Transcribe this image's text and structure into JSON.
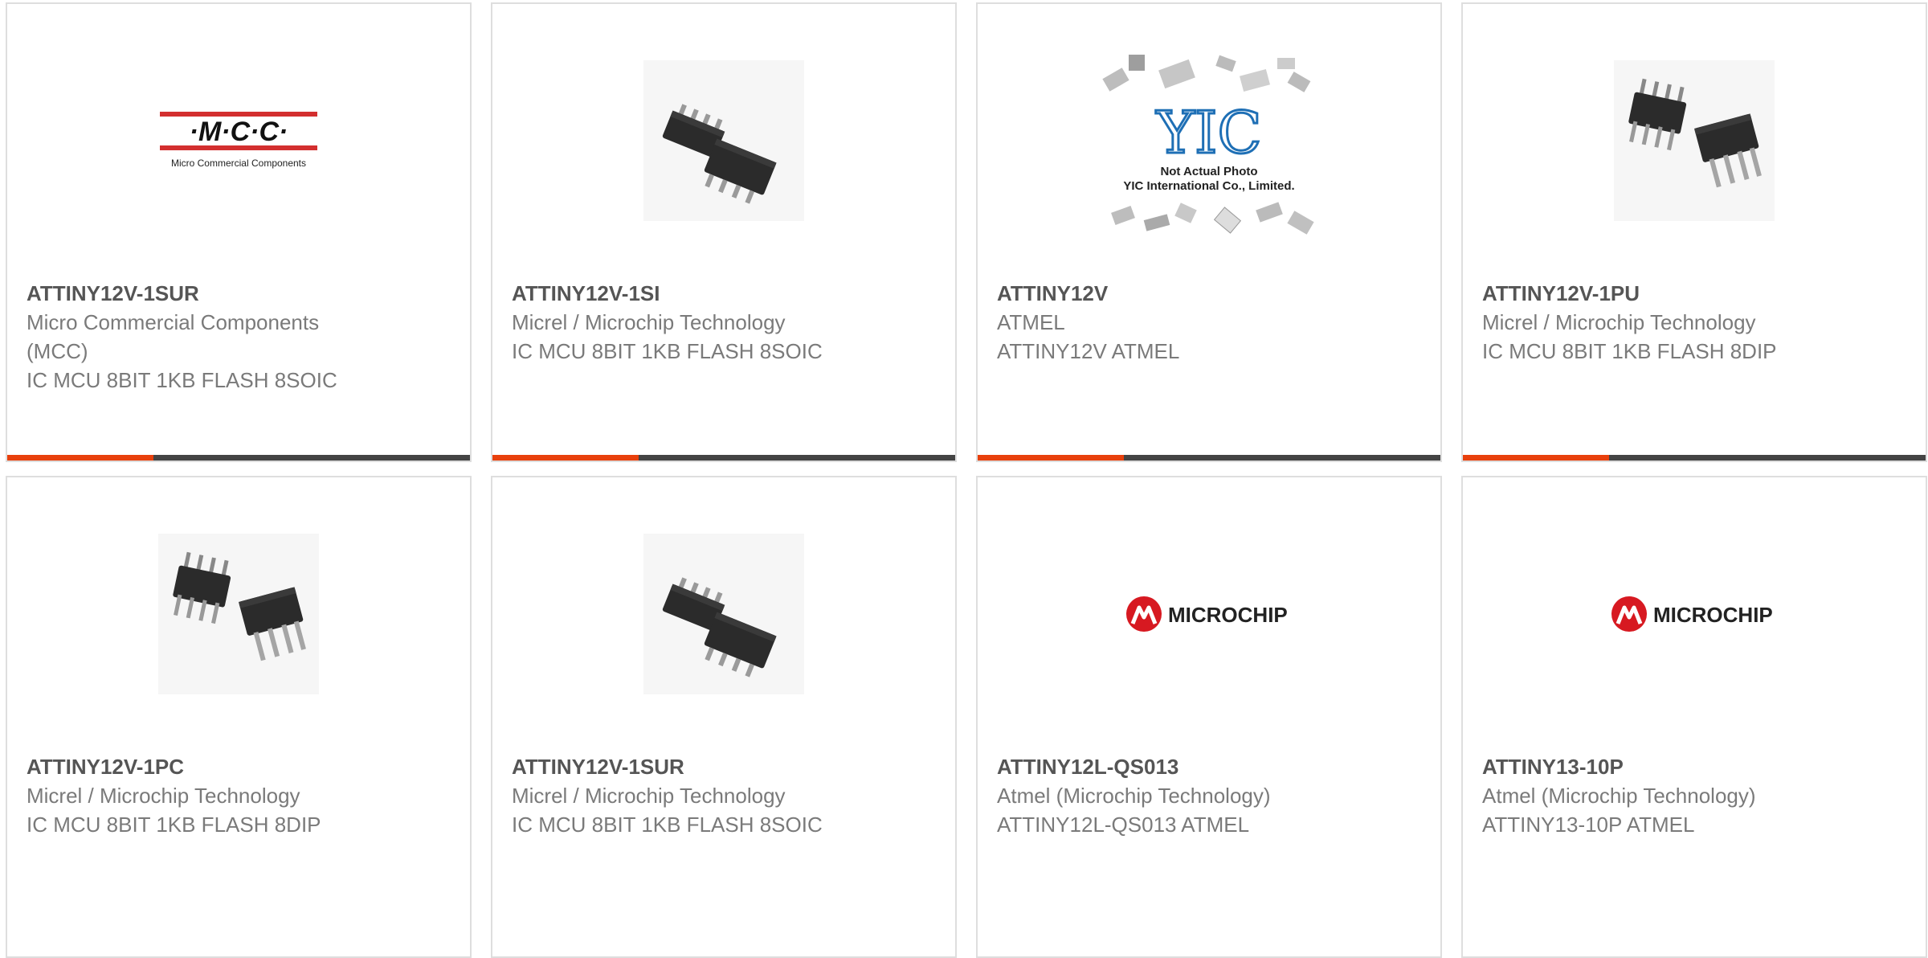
{
  "colors": {
    "accent": "#e8400c",
    "bar": "#444444",
    "border": "#dedede"
  },
  "products": [
    {
      "part": "ATTINY12V-1SUR",
      "manufacturer": "Micro Commercial Components (MCC)",
      "description": "IC MCU 8BIT 1KB FLASH 8SOIC",
      "image": "mcc-logo"
    },
    {
      "part": "ATTINY12V-1SI",
      "manufacturer": "Micrel / Microchip Technology",
      "description": "IC MCU 8BIT 1KB FLASH 8SOIC",
      "image": "soic-chips"
    },
    {
      "part": "ATTINY12V",
      "manufacturer": "ATMEL",
      "description": "ATTINY12V ATMEL",
      "image": "yic-placeholder",
      "image_text": {
        "logo": "YIC",
        "line1": "Not Actual Photo",
        "line2": "YIC International Co., Limited."
      }
    },
    {
      "part": "ATTINY12V-1PU",
      "manufacturer": "Micrel / Microchip Technology",
      "description": "IC MCU 8BIT 1KB FLASH 8DIP",
      "image": "dip-chips"
    },
    {
      "part": "ATTINY12V-1PC",
      "manufacturer": "Micrel / Microchip Technology",
      "description": "IC MCU 8BIT 1KB FLASH 8DIP",
      "image": "dip-chips"
    },
    {
      "part": "ATTINY12V-1SUR",
      "manufacturer": "Micrel / Microchip Technology",
      "description": "IC MCU 8BIT 1KB FLASH 8SOIC",
      "image": "soic-chips"
    },
    {
      "part": "ATTINY12L-QS013",
      "manufacturer": "Atmel (Microchip Technology)",
      "description": "ATTINY12L-QS013 ATMEL",
      "image": "microchip-logo"
    },
    {
      "part": "ATTINY13-10P",
      "manufacturer": "Atmel (Microchip Technology)",
      "description": "ATTINY13-10P ATMEL",
      "image": "microchip-logo"
    }
  ],
  "logos": {
    "mcc": {
      "mark": "·M·C·C·",
      "tagline": "Micro Commercial Components"
    },
    "microchip": {
      "wordmark": "MICROCHIP"
    }
  }
}
